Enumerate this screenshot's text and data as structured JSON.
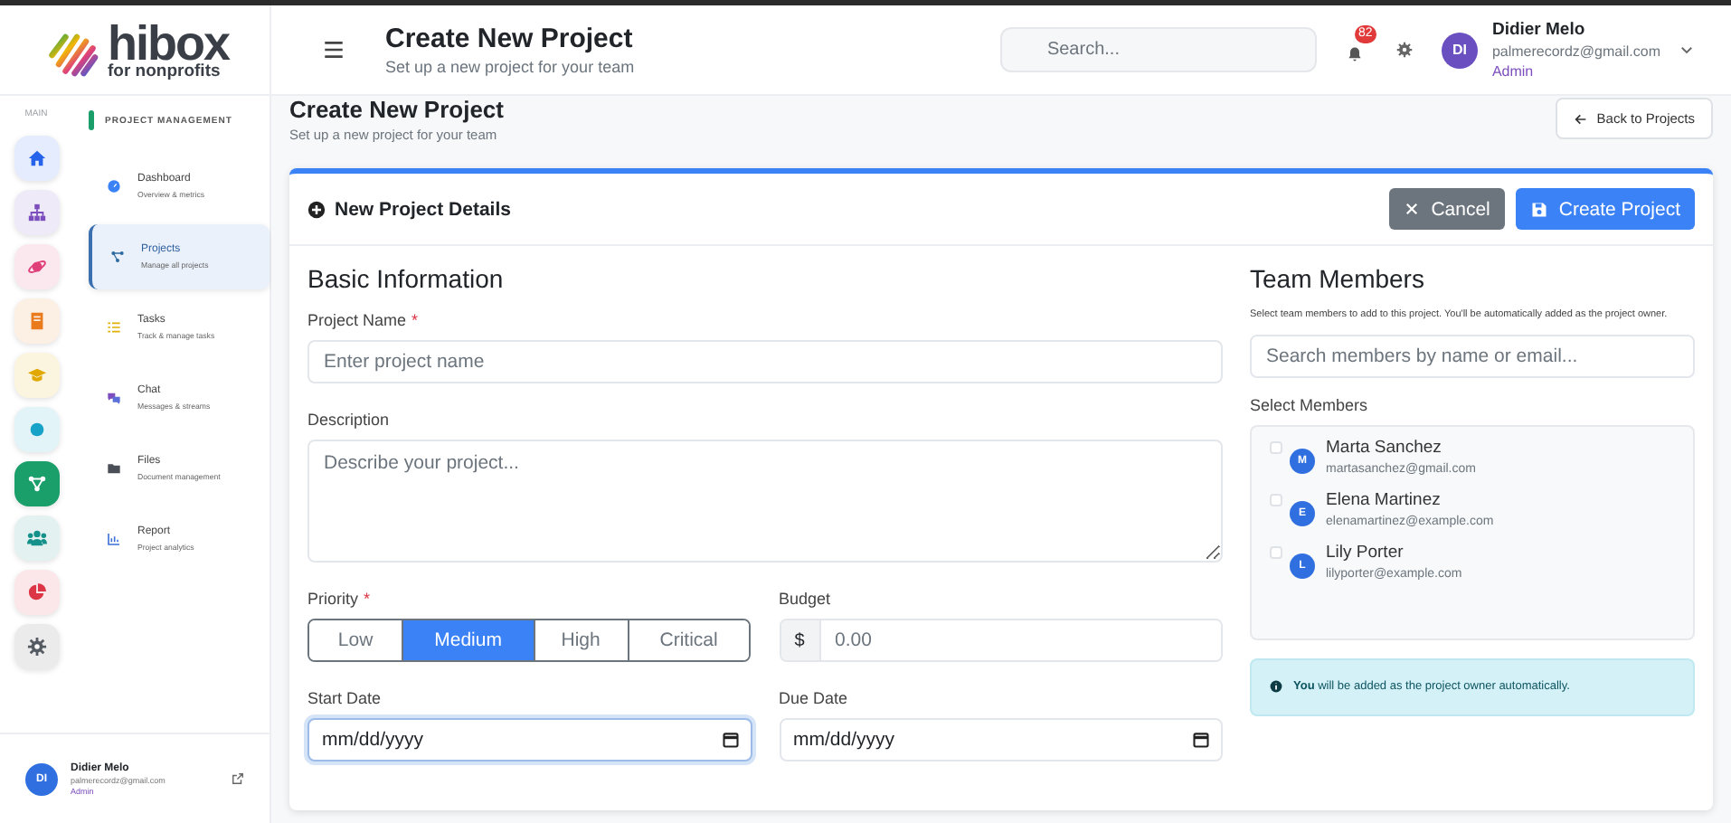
{
  "logo": {
    "name": "hibox",
    "tagline": "for nonprofits"
  },
  "header": {
    "title": "Create New Project",
    "subtitle": "Set up a new project for your team",
    "search_placeholder": "Search...",
    "notification_count": "82",
    "user": {
      "initials": "DI",
      "name": "Didier Melo",
      "email": "palmerecordz@gmail.com",
      "role": "Admin"
    }
  },
  "rail": {
    "label": "MAIN",
    "items": [
      {
        "color": "#2563eb",
        "selected": false
      },
      {
        "color": "#7c4dbd",
        "selected": false
      },
      {
        "color": "#e0407a",
        "selected": false
      },
      {
        "color": "#ea7b1c",
        "selected": false
      },
      {
        "color": "#e0a800",
        "selected": false
      },
      {
        "color": "#17a2c8",
        "selected": false
      },
      {
        "color": "#1a9e6a",
        "selected": true
      },
      {
        "color": "#14918a",
        "selected": false
      },
      {
        "color": "#dc3545",
        "selected": false
      },
      {
        "color": "#555b63",
        "selected": false
      }
    ]
  },
  "nav": {
    "section": "PROJECT MANAGEMENT",
    "items": [
      {
        "title": "Dashboard",
        "subtitle": "Overview & metrics",
        "selected": false
      },
      {
        "title": "Projects",
        "subtitle": "Manage all projects",
        "selected": true
      },
      {
        "title": "Tasks",
        "subtitle": "Track & manage tasks",
        "selected": false
      },
      {
        "title": "Chat",
        "subtitle": "Messages & streams",
        "selected": false
      },
      {
        "title": "Files",
        "subtitle": "Document management",
        "selected": false
      },
      {
        "title": "Report",
        "subtitle": "Project analytics",
        "selected": false
      }
    ]
  },
  "sidebar_user": {
    "initials": "DI",
    "name": "Didier Melo",
    "email": "palmerecordz@gmail.com",
    "role": "Admin"
  },
  "page": {
    "title": "Create New Project",
    "subtitle": "Set up a new project for your team",
    "back_button": "Back to Projects"
  },
  "card": {
    "title": "New Project Details",
    "buttons": [
      {
        "label": "Cancel",
        "kind": "secondary"
      },
      {
        "label": "Create Project",
        "kind": "primary"
      }
    ]
  },
  "basic_information": {
    "heading": "Basic Information",
    "project_name": {
      "label": "Project Name",
      "required_mark": "*",
      "placeholder": "Enter project name"
    },
    "description": {
      "label": "Description",
      "placeholder": "Describe your project..."
    },
    "priority": {
      "label": "Priority",
      "required_mark": "*",
      "options": [
        {
          "label": "Low",
          "selected": false
        },
        {
          "label": "Medium",
          "selected": true
        },
        {
          "label": "High",
          "selected": false
        },
        {
          "label": "Critical",
          "selected": false
        }
      ]
    },
    "budget": {
      "label": "Budget",
      "prefix": "$",
      "placeholder": "0.00"
    },
    "start_date": {
      "label": "Start Date",
      "placeholder": "mm/dd/yyyy",
      "focused": true
    },
    "due_date": {
      "label": "Due Date",
      "placeholder": "mm/dd/yyyy",
      "focused": false
    }
  },
  "team_members": {
    "heading": "Team Members",
    "help": "Select team members to add to this project. You'll be automatically added as the project owner.",
    "search_placeholder": "Search members by name or email...",
    "list_label": "Select Members",
    "members": [
      {
        "initial": "M",
        "name": "Marta Sanchez",
        "email": "martasanchez@gmail.com",
        "checked": false
      },
      {
        "initial": "E",
        "name": "Elena Martinez",
        "email": "elenamartinez@example.com",
        "checked": false
      },
      {
        "initial": "L",
        "name": "Lily Porter",
        "email": "lilyporter@example.com",
        "checked": false
      }
    ],
    "notice": "**You** will be added as the project owner automatically."
  }
}
